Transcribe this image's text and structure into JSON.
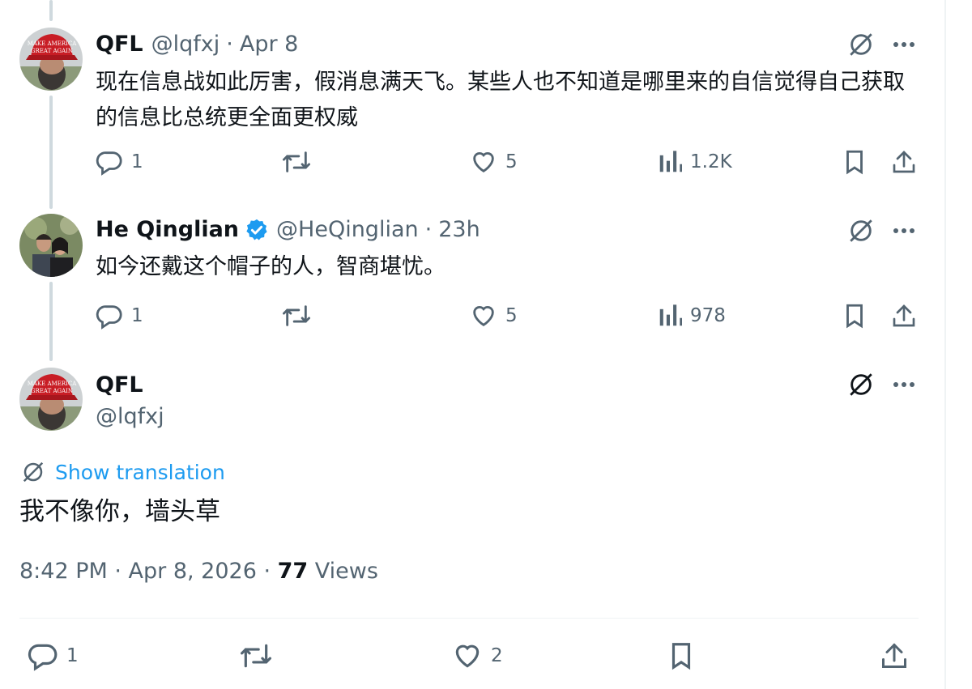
{
  "thread": [
    {
      "name": "QFL",
      "handle": "@lqfxj",
      "separator": "·",
      "time": "Apr 8",
      "text": "现在信息战如此厉害，假消息满天飞。某些人也不知道是哪里来的自信觉得自己获取的信息比总统更全面更权威",
      "replies": "1",
      "likes": "5",
      "views": "1.2K",
      "avatar_icon": "red-cap-avatar"
    },
    {
      "name": "He Qinglian",
      "verified": true,
      "handle": "@HeQinglian",
      "separator": "·",
      "time": "23h",
      "text": "如今还戴这个帽子的人，智商堪忧。",
      "replies": "1",
      "likes": "5",
      "views": "978",
      "avatar_icon": "two-people-avatar"
    }
  ],
  "main_tweet": {
    "name": "QFL",
    "handle": "@lqfxj",
    "translation_label": "Show translation",
    "text": "我不像你，墙头草",
    "timestamp": "8:42 PM · Apr 8, 2026 · ",
    "views_count": "77",
    "views_label": " Views",
    "replies": "1",
    "likes": "2"
  },
  "colors": {
    "text": "#0f1419",
    "secondary": "#536471",
    "link": "#1d9bf0",
    "thread_line": "#cfd9de",
    "divider": "#eff3f4"
  },
  "icons": [
    "grok-icon",
    "more-icon",
    "reply-icon",
    "retweet-icon",
    "like-icon",
    "views-icon",
    "bookmark-icon",
    "share-icon",
    "verified-badge-icon",
    "translate-icon"
  ]
}
